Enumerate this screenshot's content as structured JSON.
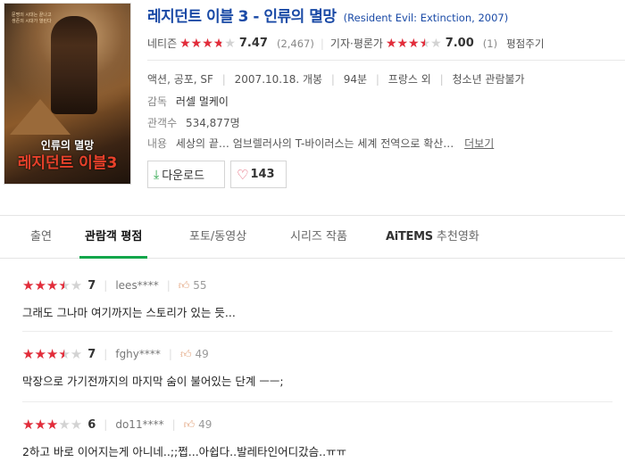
{
  "poster": {
    "tagline": "문명의 시대는 끝나고 생존의 시대가 열린다",
    "title_small": "인류의 멸망",
    "title_big": "레지던트 이블3"
  },
  "movie": {
    "title": "레지던트 이블 3 - 인류의 멸망",
    "original_title": "(Resident Evil: Extinction, 2007)"
  },
  "ratings": {
    "netizen_label": "네티즌",
    "netizen_score": "7.47",
    "netizen_score_fraction": 0.747,
    "netizen_count": "(2,467)",
    "critic_label": "기자·평론가",
    "critic_score": "7.00",
    "critic_score_fraction": 0.7,
    "critic_count": "(1)",
    "more_label": "평점주기"
  },
  "info": {
    "genre": "액션, 공포, SF",
    "release": "2007.10.18. 개봉",
    "runtime": "94분",
    "country": "프랑스 외",
    "age_rating": "청소년 관람불가",
    "director_label": "감독",
    "director": "러셀 멀케이",
    "audience_label": "관객수",
    "audience": "534,877명",
    "story_label": "내용",
    "story": "세상의 끝… 엄브렐러사의 T-바이러스는 세계 전역으로 확산…",
    "story_more": "더보기"
  },
  "buttons": {
    "download_label": "다운로드",
    "like_count": "143"
  },
  "tabs": {
    "cast": "출연",
    "reviews": "관람객 평점",
    "media": "포토/동영상",
    "series": "시리즈 작품",
    "aitems_brand": "AiTEMS",
    "aitems_rest": " 추천영화"
  },
  "reviews": [
    {
      "score": "7",
      "score_fraction": 0.7,
      "user": "lees****",
      "likes": "55",
      "text": "그래도 그나마 여기까지는 스토리가 있는 듯..."
    },
    {
      "score": "7",
      "score_fraction": 0.7,
      "user": "fghy****",
      "likes": "49",
      "text": "막장으로 가기전까지의 마지막 숨이 불어있는 단계 ㅡㅡ;"
    },
    {
      "score": "6",
      "score_fraction": 0.6,
      "user": "do11****",
      "likes": "49",
      "text": "2하고 바로 이어지는게 아니네..;;쩝...아쉽다..발레타인어디갔슴..ㅠㅠ"
    }
  ],
  "colors": {
    "star": "#e32c3a",
    "link": "#1a4aa6",
    "tab_active": "#12a64b"
  }
}
